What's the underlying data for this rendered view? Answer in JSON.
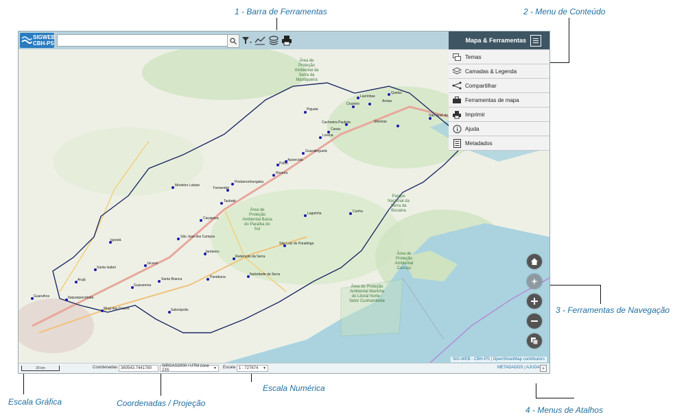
{
  "annotations": {
    "toolbar": "1 - Barra de Ferramentas",
    "content_menu": "2 - Menu de Conteúdo",
    "navigation": "3 - Ferramentas de Navegação",
    "shortcuts": "4 - Menus de Atalhos",
    "graphic_scale": "Escala Gráfica",
    "coordinates": "Coordenadas / Projeção",
    "numeric_scale": "Escala Numérica"
  },
  "app": {
    "logo_line1": "SIGWEB",
    "logo_line2": "CBH-PS",
    "search": {
      "value": "",
      "placeholder": ""
    }
  },
  "toolbar_icons": [
    "search-icon",
    "filter-icon",
    "chart-icon",
    "layers-stack-icon",
    "print-icon"
  ],
  "sidebar": {
    "title": "Mapa & Ferramentas",
    "items": [
      {
        "label": "Temas",
        "icon": "themes-icon"
      },
      {
        "label": "Camadas & Legenda",
        "icon": "layers-icon"
      },
      {
        "label": "Compartilhar",
        "icon": "share-icon"
      },
      {
        "label": "Ferramentas de mapa",
        "icon": "toolbox-icon"
      },
      {
        "label": "Imprimir",
        "icon": "print-icon"
      },
      {
        "label": "Ajuda",
        "icon": "info-icon"
      },
      {
        "label": "Metadados",
        "icon": "document-icon"
      }
    ]
  },
  "navigation_buttons": [
    "home-icon",
    "locate-icon",
    "zoom-in-icon",
    "zoom-out-icon",
    "basemap-icon"
  ],
  "map": {
    "attribution": "SIG-WEB - CBH-PS | OpenStreetMap contributors",
    "region_labels": {
      "apa_mantiqueira": "Área de Proteção Ambiental da Serra da Mantiqueira",
      "apa_paraiba": "Área de Proteção Ambiental Bacia do Paraíba do Sul",
      "pn_bocaina": "Parque Nacional da Serra da Bocaina",
      "apa_cairucu": "Área de Proteção Ambiental Cairuçu",
      "apa_cunhambebe": "Área de Proteção Ambiental Marinha do Litoral Norte - Setor Cunhambebe"
    },
    "cities": [
      "Queluz",
      "Lavrinhas",
      "Cruzeiro",
      "Areias",
      "Silveiras",
      "Cachoeira Paulista",
      "Piquete",
      "Lorena",
      "São José do Barreiro",
      "Canas",
      "Guaratinguetá",
      "Aparecida",
      "Potim",
      "Roseira",
      "Pindamonhangaba",
      "Tremembé",
      "Taubaté",
      "Monteiro Lobato",
      "Lagoinha",
      "Cunha",
      "Caçapava",
      "São José dos Campos",
      "São Luiz do Paraitinga",
      "Igaratá",
      "Jambeiro",
      "Redenção da Serra",
      "Santa Isabel",
      "Jacareí",
      "Natividade da Serra",
      "Paraibuna",
      "Santa Branca",
      "Guararema",
      "Arujá",
      "Guarulhos",
      "Itaquaquecetuba",
      "Salesópolis",
      "Mogi das Cruzes"
    ]
  },
  "status_bar": {
    "scale_bar_label": "20 km",
    "coordinates_label": "Coordenadas :",
    "coordinates_value": "360543.7441780",
    "projection_value": "SIRGAS2000 / UTM zone 23S",
    "scale_label": "Escala :",
    "scale_value": "1 : 727674",
    "links": "METADADOS | AJUDA",
    "toggle": "»"
  }
}
